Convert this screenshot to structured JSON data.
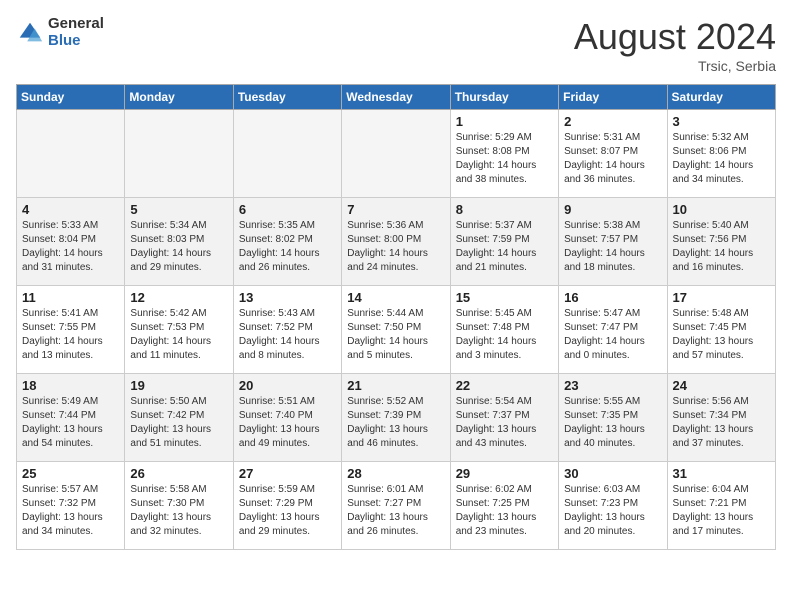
{
  "header": {
    "logo_general": "General",
    "logo_blue": "Blue",
    "month_title": "August 2024",
    "location": "Trsic, Serbia"
  },
  "weekdays": [
    "Sunday",
    "Monday",
    "Tuesday",
    "Wednesday",
    "Thursday",
    "Friday",
    "Saturday"
  ],
  "weeks": [
    [
      {
        "day": "",
        "empty": true
      },
      {
        "day": "",
        "empty": true
      },
      {
        "day": "",
        "empty": true
      },
      {
        "day": "",
        "empty": true
      },
      {
        "day": "1",
        "sunrise": "5:29 AM",
        "sunset": "8:08 PM",
        "daylight": "14 hours and 38 minutes."
      },
      {
        "day": "2",
        "sunrise": "5:31 AM",
        "sunset": "8:07 PM",
        "daylight": "14 hours and 36 minutes."
      },
      {
        "day": "3",
        "sunrise": "5:32 AM",
        "sunset": "8:06 PM",
        "daylight": "14 hours and 34 minutes."
      }
    ],
    [
      {
        "day": "4",
        "sunrise": "5:33 AM",
        "sunset": "8:04 PM",
        "daylight": "14 hours and 31 minutes."
      },
      {
        "day": "5",
        "sunrise": "5:34 AM",
        "sunset": "8:03 PM",
        "daylight": "14 hours and 29 minutes."
      },
      {
        "day": "6",
        "sunrise": "5:35 AM",
        "sunset": "8:02 PM",
        "daylight": "14 hours and 26 minutes."
      },
      {
        "day": "7",
        "sunrise": "5:36 AM",
        "sunset": "8:00 PM",
        "daylight": "14 hours and 24 minutes."
      },
      {
        "day": "8",
        "sunrise": "5:37 AM",
        "sunset": "7:59 PM",
        "daylight": "14 hours and 21 minutes."
      },
      {
        "day": "9",
        "sunrise": "5:38 AM",
        "sunset": "7:57 PM",
        "daylight": "14 hours and 18 minutes."
      },
      {
        "day": "10",
        "sunrise": "5:40 AM",
        "sunset": "7:56 PM",
        "daylight": "14 hours and 16 minutes."
      }
    ],
    [
      {
        "day": "11",
        "sunrise": "5:41 AM",
        "sunset": "7:55 PM",
        "daylight": "14 hours and 13 minutes."
      },
      {
        "day": "12",
        "sunrise": "5:42 AM",
        "sunset": "7:53 PM",
        "daylight": "14 hours and 11 minutes."
      },
      {
        "day": "13",
        "sunrise": "5:43 AM",
        "sunset": "7:52 PM",
        "daylight": "14 hours and 8 minutes."
      },
      {
        "day": "14",
        "sunrise": "5:44 AM",
        "sunset": "7:50 PM",
        "daylight": "14 hours and 5 minutes."
      },
      {
        "day": "15",
        "sunrise": "5:45 AM",
        "sunset": "7:48 PM",
        "daylight": "14 hours and 3 minutes."
      },
      {
        "day": "16",
        "sunrise": "5:47 AM",
        "sunset": "7:47 PM",
        "daylight": "14 hours and 0 minutes."
      },
      {
        "day": "17",
        "sunrise": "5:48 AM",
        "sunset": "7:45 PM",
        "daylight": "13 hours and 57 minutes."
      }
    ],
    [
      {
        "day": "18",
        "sunrise": "5:49 AM",
        "sunset": "7:44 PM",
        "daylight": "13 hours and 54 minutes."
      },
      {
        "day": "19",
        "sunrise": "5:50 AM",
        "sunset": "7:42 PM",
        "daylight": "13 hours and 51 minutes."
      },
      {
        "day": "20",
        "sunrise": "5:51 AM",
        "sunset": "7:40 PM",
        "daylight": "13 hours and 49 minutes."
      },
      {
        "day": "21",
        "sunrise": "5:52 AM",
        "sunset": "7:39 PM",
        "daylight": "13 hours and 46 minutes."
      },
      {
        "day": "22",
        "sunrise": "5:54 AM",
        "sunset": "7:37 PM",
        "daylight": "13 hours and 43 minutes."
      },
      {
        "day": "23",
        "sunrise": "5:55 AM",
        "sunset": "7:35 PM",
        "daylight": "13 hours and 40 minutes."
      },
      {
        "day": "24",
        "sunrise": "5:56 AM",
        "sunset": "7:34 PM",
        "daylight": "13 hours and 37 minutes."
      }
    ],
    [
      {
        "day": "25",
        "sunrise": "5:57 AM",
        "sunset": "7:32 PM",
        "daylight": "13 hours and 34 minutes."
      },
      {
        "day": "26",
        "sunrise": "5:58 AM",
        "sunset": "7:30 PM",
        "daylight": "13 hours and 32 minutes."
      },
      {
        "day": "27",
        "sunrise": "5:59 AM",
        "sunset": "7:29 PM",
        "daylight": "13 hours and 29 minutes."
      },
      {
        "day": "28",
        "sunrise": "6:01 AM",
        "sunset": "7:27 PM",
        "daylight": "13 hours and 26 minutes."
      },
      {
        "day": "29",
        "sunrise": "6:02 AM",
        "sunset": "7:25 PM",
        "daylight": "13 hours and 23 minutes."
      },
      {
        "day": "30",
        "sunrise": "6:03 AM",
        "sunset": "7:23 PM",
        "daylight": "13 hours and 20 minutes."
      },
      {
        "day": "31",
        "sunrise": "6:04 AM",
        "sunset": "7:21 PM",
        "daylight": "13 hours and 17 minutes."
      }
    ]
  ],
  "labels": {
    "sunrise": "Sunrise:",
    "sunset": "Sunset:",
    "daylight": "Daylight:"
  }
}
